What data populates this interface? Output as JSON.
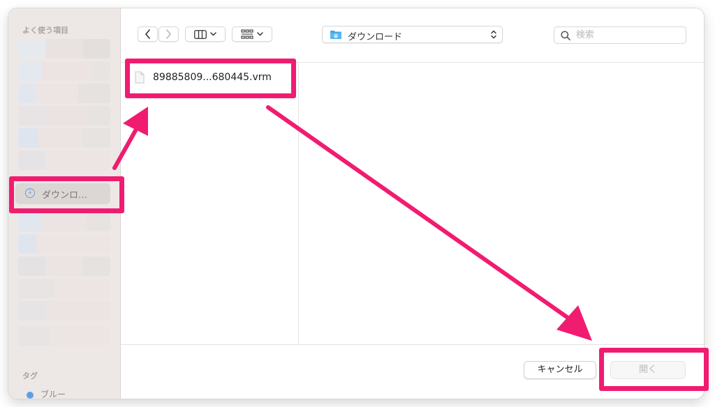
{
  "sidebar": {
    "favorites_title": "よく使う項目",
    "selected_item": {
      "label": "ダウンロ…",
      "icon": "download-circle-icon"
    },
    "tags_title": "タグ",
    "tag_item": {
      "label": "ブルー",
      "color": "#5aa0e8"
    }
  },
  "toolbar": {
    "back_icon": "chevron-left-icon",
    "forward_icon": "chevron-right-icon",
    "view_columns_icon": "columns-view-icon",
    "group_icon": "grid-group-icon",
    "location": {
      "label": "ダウンロード",
      "icon": "folder-icon"
    },
    "search": {
      "placeholder": "検索",
      "value": ""
    }
  },
  "files": [
    {
      "name": "89885809...680445.vrm",
      "icon": "document-icon"
    }
  ],
  "buttons": {
    "cancel": "キャンセル",
    "open": "開く"
  },
  "annotations": {
    "highlight_color": "#f01c70"
  }
}
